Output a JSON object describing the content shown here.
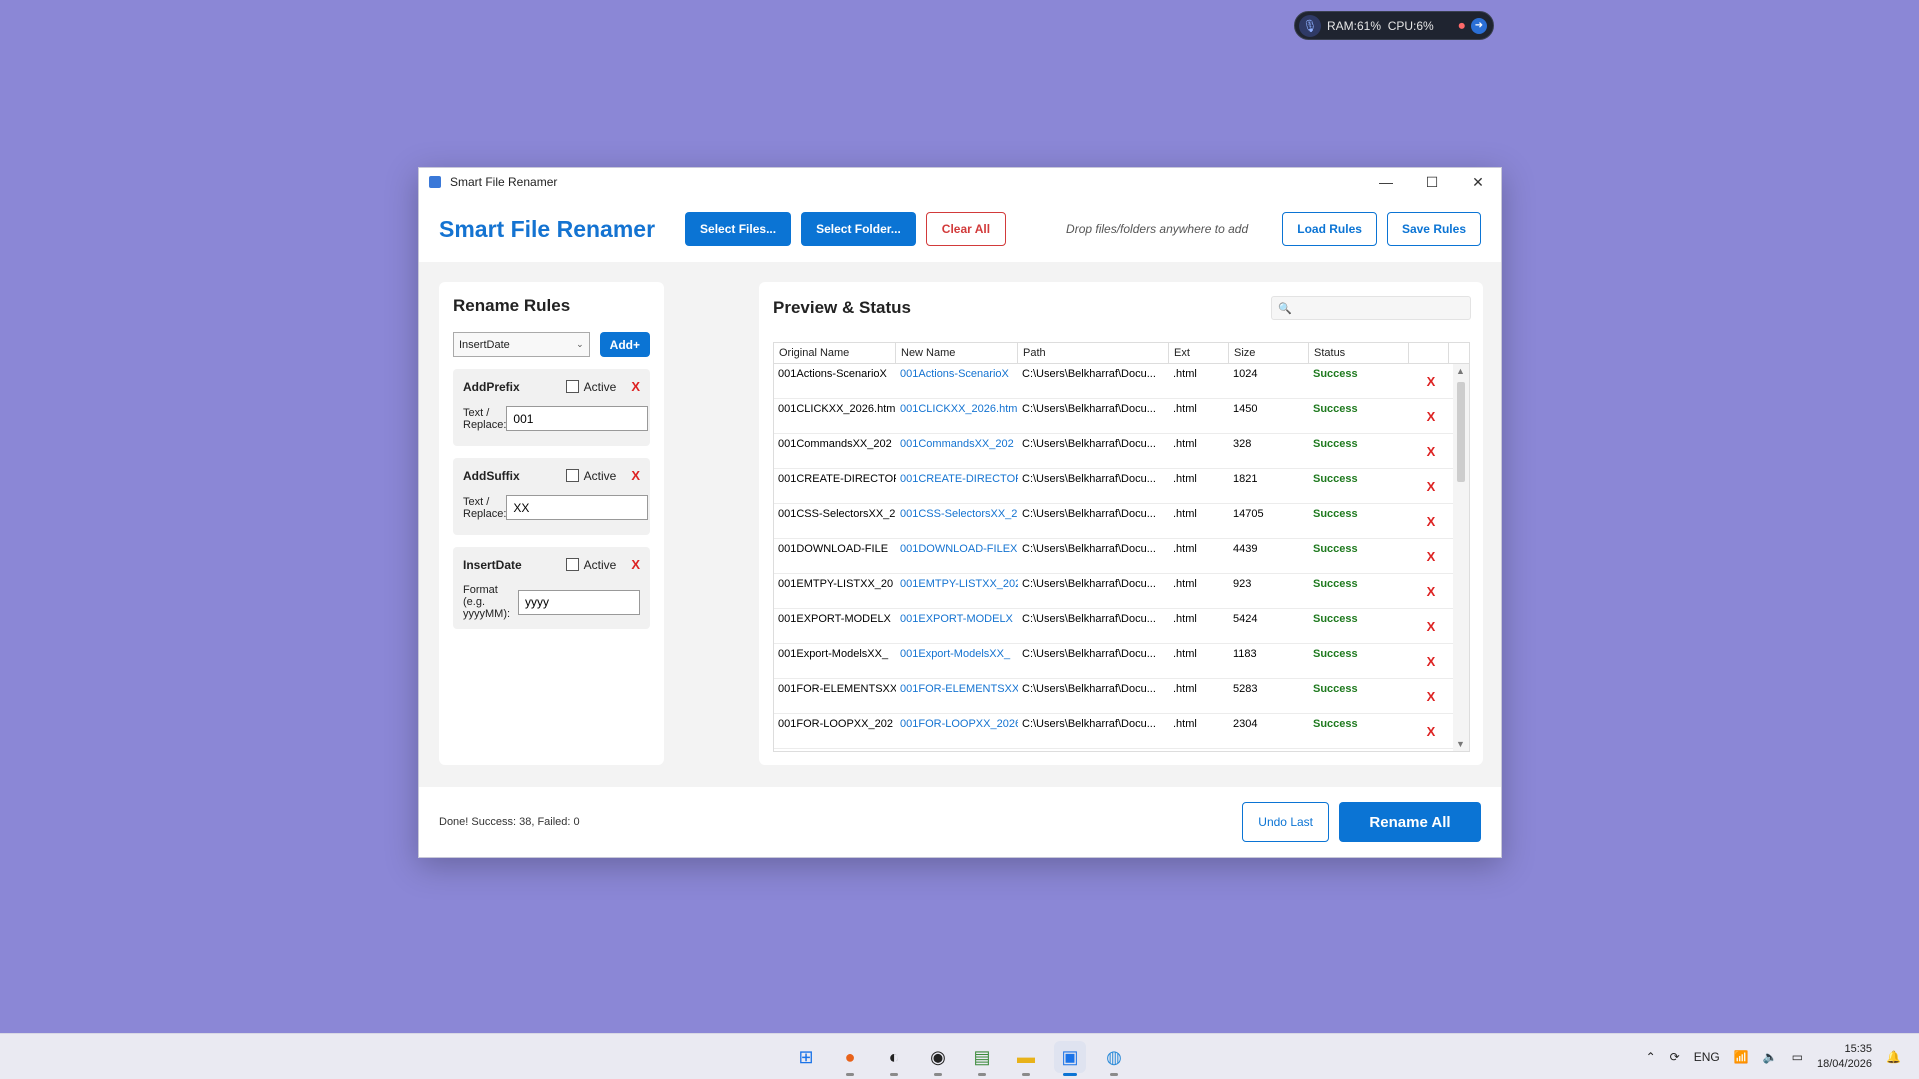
{
  "sysmon": {
    "ram": "RAM:61%",
    "cpu": "CPU:6%"
  },
  "window": {
    "title": "Smart File Renamer"
  },
  "header": {
    "brand": "Smart File Renamer",
    "select_files": "Select Files...",
    "select_folder": "Select Folder...",
    "clear_all": "Clear All",
    "drop_hint": "Drop files/folders anywhere to add",
    "load_rules": "Load Rules",
    "save_rules": "Save Rules"
  },
  "rules": {
    "title": "Rename Rules",
    "selected_rule": "InsertDate",
    "add_label": "Add+",
    "items": [
      {
        "name": "AddPrefix",
        "active_label": "Active",
        "field_label": "Text / Replace:",
        "value": "001"
      },
      {
        "name": "AddSuffix",
        "active_label": "Active",
        "field_label": "Text / Replace:",
        "value": "XX"
      },
      {
        "name": "InsertDate",
        "active_label": "Active",
        "field_label": "Format (e.g. yyyyMM):",
        "value": "yyyy"
      }
    ]
  },
  "preview": {
    "title": "Preview & Status",
    "columns": [
      "Original Name",
      "New Name",
      "Path",
      "Ext",
      "Size",
      "Status"
    ],
    "rows": [
      {
        "original": "001Actions-ScenarioX",
        "new": "001Actions-ScenarioX",
        "path": "C:\\Users\\Belkharraf\\Docu...",
        "ext": ".html",
        "size": "1024",
        "status": "Success"
      },
      {
        "original": "001CLICKXX_2026.htm",
        "new": "001CLICKXX_2026.htm",
        "path": "C:\\Users\\Belkharraf\\Docu...",
        "ext": ".html",
        "size": "1450",
        "status": "Success"
      },
      {
        "original": "001CommandsXX_202",
        "new": "001CommandsXX_202",
        "path": "C:\\Users\\Belkharraf\\Docu...",
        "ext": ".html",
        "size": "328",
        "status": "Success"
      },
      {
        "original": "001CREATE-DIRECTOR",
        "new": "001CREATE-DIRECTOR",
        "path": "C:\\Users\\Belkharraf\\Docu...",
        "ext": ".html",
        "size": "1821",
        "status": "Success"
      },
      {
        "original": "001CSS-SelectorsXX_2",
        "new": "001CSS-SelectorsXX_2",
        "path": "C:\\Users\\Belkharraf\\Docu...",
        "ext": ".html",
        "size": "14705",
        "status": "Success"
      },
      {
        "original": "001DOWNLOAD-FILE",
        "new": "001DOWNLOAD-FILEX",
        "path": "C:\\Users\\Belkharraf\\Docu...",
        "ext": ".html",
        "size": "4439",
        "status": "Success"
      },
      {
        "original": "001EMTPY-LISTXX_20",
        "new": "001EMTPY-LISTXX_202",
        "path": "C:\\Users\\Belkharraf\\Docu...",
        "ext": ".html",
        "size": "923",
        "status": "Success"
      },
      {
        "original": "001EXPORT-MODELX",
        "new": "001EXPORT-MODELX",
        "path": "C:\\Users\\Belkharraf\\Docu...",
        "ext": ".html",
        "size": "5424",
        "status": "Success"
      },
      {
        "original": "001Export-ModelsXX_",
        "new": "001Export-ModelsXX_",
        "path": "C:\\Users\\Belkharraf\\Docu...",
        "ext": ".html",
        "size": "1183",
        "status": "Success"
      },
      {
        "original": "001FOR-ELEMENTSXX",
        "new": "001FOR-ELEMENTSXX_",
        "path": "C:\\Users\\Belkharraf\\Docu...",
        "ext": ".html",
        "size": "5283",
        "status": "Success"
      },
      {
        "original": "001FOR-LOOPXX_202",
        "new": "001FOR-LOOPXX_2026",
        "path": "C:\\Users\\Belkharraf\\Docu...",
        "ext": ".html",
        "size": "2304",
        "status": "Success"
      }
    ],
    "delete_label": "X"
  },
  "footer": {
    "status": "Done! Success: 38, Failed: 0",
    "undo": "Undo Last",
    "rename": "Rename All"
  },
  "taskbar": {
    "lang": "ENG",
    "time": "15:35",
    "date": "18/04/2026"
  },
  "colors": {
    "accent": "#0b74d4",
    "danger": "#d23a3a",
    "success": "#1f7a1f",
    "desktop": "#8b87d6"
  }
}
